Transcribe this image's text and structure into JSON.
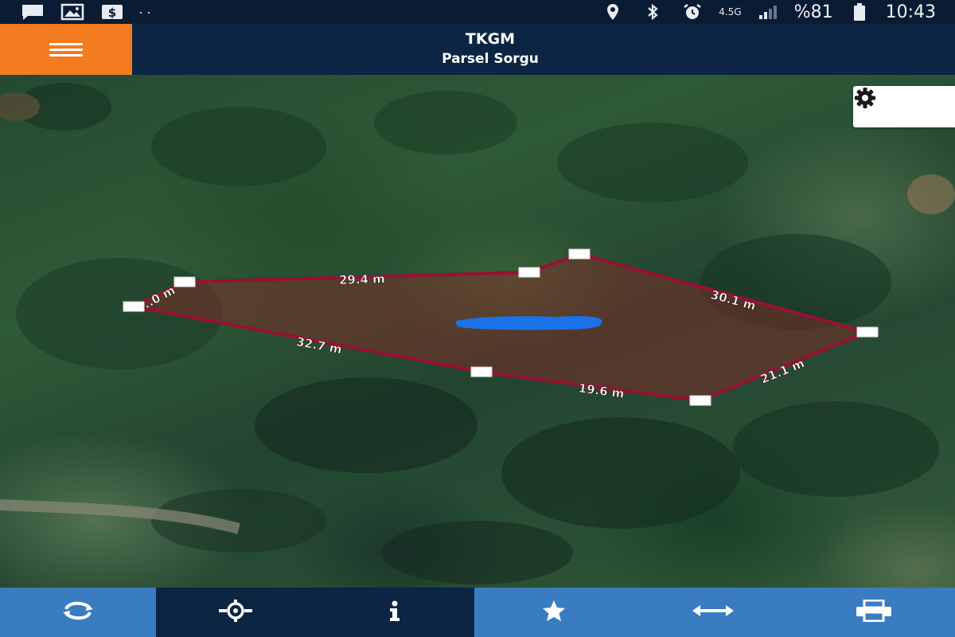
{
  "status_bar": {
    "network_type": "4.5G",
    "battery_text": "%81",
    "time": "10:43",
    "overflow_dots": "··"
  },
  "header": {
    "title": "TKGM",
    "subtitle": "Parsel Sorgu"
  },
  "map": {
    "parcel_edges": [
      {
        "label": "29.4 m"
      },
      {
        "label": "30.1 m"
      },
      {
        "label": "21.1 m"
      },
      {
        "label": "19.6 m"
      },
      {
        "label": "32.7 m"
      },
      {
        "label": "...0 m"
      }
    ]
  },
  "toolbar": {
    "buttons": [
      {
        "icon": "refresh-icon"
      },
      {
        "icon": "locate-icon"
      },
      {
        "icon": "info-icon"
      },
      {
        "icon": "star-icon"
      },
      {
        "icon": "measure-icon"
      },
      {
        "icon": "print-icon"
      }
    ]
  },
  "colors": {
    "accent_orange": "#f47b20",
    "header_navy": "#0b2542",
    "toolbar_blue": "#3a7cc0",
    "parcel_outline": "#9a1030",
    "marker_blue": "#1a73e8"
  }
}
